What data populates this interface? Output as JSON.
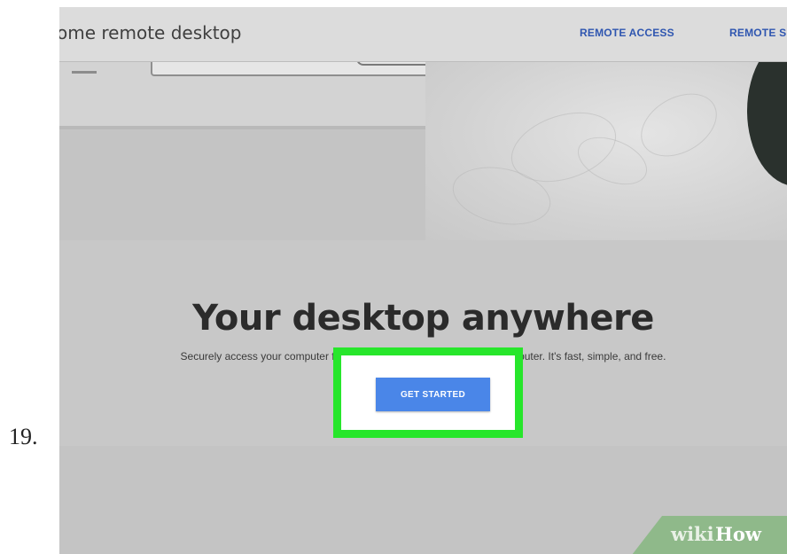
{
  "step": {
    "number": "19."
  },
  "header": {
    "brand": "ome remote desktop",
    "nav": [
      "REMOTE ACCESS",
      "REMOTE S"
    ]
  },
  "hero": {
    "headline": "Your desktop anywhere",
    "subtext": "Securely access your computer from your phone, tablet, or another computer. It's fast, simple, and free.",
    "cta_label": "GET STARTED"
  },
  "annotation": {
    "highlight_color": "#27e62b"
  },
  "watermark": {
    "wiki": "wiki",
    "how": "How"
  },
  "colors": {
    "accent": "#4a86e8",
    "link": "#2f56b0",
    "watermark_bg": "#8fb98a"
  }
}
